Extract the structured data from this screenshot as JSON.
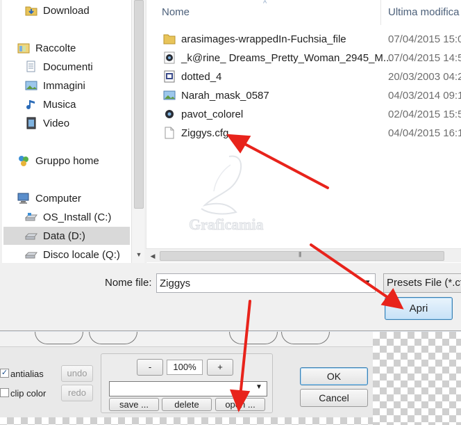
{
  "nav": {
    "items": [
      {
        "label": "Download",
        "icon": "download-folder-icon"
      },
      {
        "label": "Raccolte",
        "icon": "libraries-icon"
      },
      {
        "label": "Documenti",
        "icon": "documents-icon"
      },
      {
        "label": "Immagini",
        "icon": "pictures-icon"
      },
      {
        "label": "Musica",
        "icon": "music-icon"
      },
      {
        "label": "Video",
        "icon": "video-icon"
      },
      {
        "label": "Gruppo home",
        "icon": "homegroup-icon"
      },
      {
        "label": "Computer",
        "icon": "computer-icon"
      },
      {
        "label": "OS_Install (C:)",
        "icon": "drive-icon"
      },
      {
        "label": "Data (D:)",
        "icon": "drive-icon"
      },
      {
        "label": "Disco locale (Q:)",
        "icon": "drive-icon"
      }
    ]
  },
  "files": {
    "col_name": "Nome",
    "col_date": "Ultima modifica",
    "rows": [
      {
        "name": "arasimages-wrappedIn-Fuchsia_file",
        "date": "07/04/2015 15:0",
        "icon": "folder-icon"
      },
      {
        "name": "_k@rine_ Dreams_Pretty_Woman_2945_M...",
        "date": "07/04/2015 14:5",
        "icon": "psp-image-icon"
      },
      {
        "name": "dotted_4",
        "date": "20/03/2003 04:2",
        "icon": "texture-file-icon"
      },
      {
        "name": "Narah_mask_0587",
        "date": "04/03/2014 09:1",
        "icon": "image-file-icon"
      },
      {
        "name": "pavot_colorel",
        "date": "02/04/2015 15:5",
        "icon": "psp-image-icon"
      },
      {
        "name": "Ziggys.cfg",
        "date": "04/04/2015 16:1",
        "icon": "blank-file-icon"
      }
    ]
  },
  "watermark": "Graficamia",
  "dialog": {
    "filename_label": "Nome file:",
    "filename_value": "Ziggys",
    "filetype_value": "Presets File (*.cfg",
    "open_label": "Apri"
  },
  "editor": {
    "antialias_label": "antialias",
    "clipcolor_label": "clip color",
    "undo_label": "undo",
    "redo_label": "redo",
    "zoom_minus": "-",
    "zoom_value": "100%",
    "zoom_plus": "+",
    "save_label": "save ...",
    "delete_label": "delete",
    "open_label": "open ...",
    "ok_label": "OK",
    "cancel_label": "Cancel"
  },
  "colors": {
    "arrow": "#e8231b",
    "header_text": "#4c607a"
  }
}
